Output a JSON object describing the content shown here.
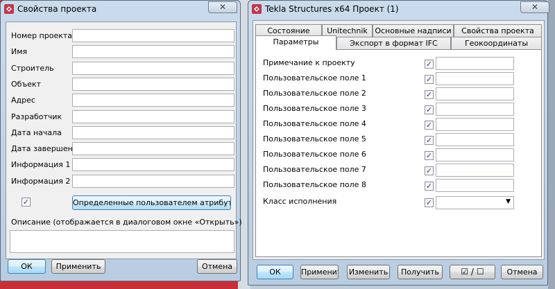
{
  "left_window": {
    "title": "Свойства проекта",
    "close_glyph": "✕",
    "fields": [
      {
        "label": "Номер проекта",
        "value": ""
      },
      {
        "label": "Имя",
        "value": ""
      },
      {
        "label": "Строитель",
        "value": ""
      },
      {
        "label": "Объект",
        "value": ""
      },
      {
        "label": "Адрес",
        "value": ""
      },
      {
        "label": "Разработчик",
        "value": ""
      },
      {
        "label": "Дата начала",
        "value": ""
      },
      {
        "label": "Дата завершения",
        "value": ""
      },
      {
        "label": "Информация 1",
        "value": ""
      },
      {
        "label": "Информация 2",
        "value": ""
      }
    ],
    "check_glyph": "✓",
    "user_attributes_button": "Определенные пользователем атрибуты...",
    "description_label": "Описание (отображается в диалоговом окне «Открыть»)",
    "description_value": "",
    "ok_button": "ОК",
    "apply_button": "Применить",
    "cancel_button": "Отмена"
  },
  "right_window": {
    "title": "Tekla Structures x64  Проект (1)",
    "close_glyph": "✕",
    "tabs_row1": [
      "Состояние",
      "Unitechnik",
      "Основные надписи",
      "Свойства проекта"
    ],
    "tabs_row2": [
      "Параметры",
      "Экспорт в формат IFC",
      "Геокоординаты"
    ],
    "active_tab": "Параметры",
    "rows": [
      {
        "label": "Примечание к проекту",
        "checked": true,
        "value": ""
      },
      {
        "label": "Пользовательское поле 1",
        "checked": true,
        "value": ""
      },
      {
        "label": "Пользовательское поле 2",
        "checked": true,
        "value": ""
      },
      {
        "label": "Пользовательское поле 3",
        "checked": true,
        "value": ""
      },
      {
        "label": "Пользовательское поле 4",
        "checked": true,
        "value": ""
      },
      {
        "label": "Пользовательское поле 5",
        "checked": true,
        "value": ""
      },
      {
        "label": "Пользовательское поле 6",
        "checked": true,
        "value": ""
      },
      {
        "label": "Пользовательское поле 7",
        "checked": true,
        "value": ""
      },
      {
        "label": "Пользовательское поле 8",
        "checked": true,
        "value": ""
      }
    ],
    "class_label": "Класс исполнения",
    "class_checked": true,
    "class_value": "",
    "combo_arrow": "▼",
    "check_glyph": "✓",
    "buttons": {
      "ok": "ОК",
      "apply": "Применить",
      "modify": "Изменить",
      "get": "Получить",
      "toggle": "☑ / ☐",
      "cancel": "Отмена"
    }
  }
}
